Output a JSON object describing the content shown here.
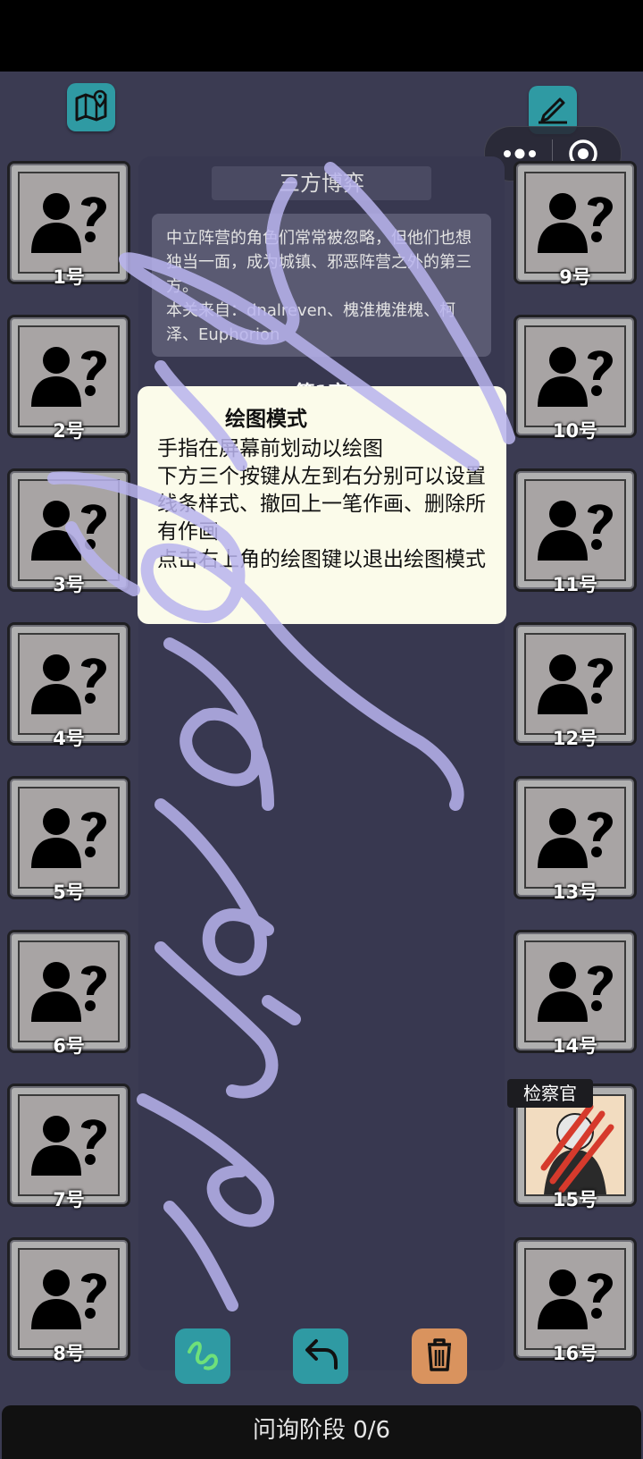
{
  "header": {
    "map_icon": "map-pin-icon",
    "draw_icon": "pen-icon",
    "menu_icon": "more-dots-icon",
    "close_icon": "target-circle-icon"
  },
  "mode": {
    "title": "三方博弈",
    "description_line1": "中立阵营的角色们常常被忽略，但他们也想独当一面，成为城镇、邪恶阵营之外的第三方。",
    "description_line2": "本关来自：dnalreven、槐淮槐淮槐、柯泽、Euphorion",
    "subtitle": "第1夜"
  },
  "tooltip": {
    "title": "绘图模式",
    "line1": "手指在屏幕前划动以绘图",
    "line2": "下方三个按键从左到右分别可以设置线条样式、撤回上一笔作画、删除所有作画",
    "line3": "点击右上角的绘图键以退出绘图模式"
  },
  "players": {
    "left": [
      {
        "label": "1号",
        "icon": "unknown-person-icon"
      },
      {
        "label": "2号",
        "icon": "unknown-person-icon"
      },
      {
        "label": "3号",
        "icon": "unknown-person-icon"
      },
      {
        "label": "4号",
        "icon": "unknown-person-icon"
      },
      {
        "label": "5号",
        "icon": "unknown-person-icon"
      },
      {
        "label": "6号",
        "icon": "unknown-person-icon"
      },
      {
        "label": "7号",
        "icon": "unknown-person-icon"
      },
      {
        "label": "8号",
        "icon": "unknown-person-icon"
      }
    ],
    "right": [
      {
        "label": "9号",
        "icon": "unknown-person-icon"
      },
      {
        "label": "10号",
        "icon": "unknown-person-icon"
      },
      {
        "label": "11号",
        "icon": "unknown-person-icon"
      },
      {
        "label": "12号",
        "icon": "unknown-person-icon"
      },
      {
        "label": "13号",
        "icon": "unknown-person-icon"
      },
      {
        "label": "14号",
        "icon": "unknown-person-icon"
      },
      {
        "label": "15号",
        "icon": "character-portrait",
        "role_badge": "检察官"
      },
      {
        "label": "16号",
        "icon": "unknown-person-icon"
      }
    ]
  },
  "tools": {
    "line_style_icon": "squiggle-line-icon",
    "undo_icon": "undo-arrow-icon",
    "delete_icon": "trash-icon"
  },
  "status": {
    "phase": "问询阶段 0/6"
  },
  "colors": {
    "background": "#3b3b52",
    "accent_teal": "#2f9aa3",
    "delete_orange": "#d9935e",
    "drawing_stroke": "#b9b4ee"
  }
}
